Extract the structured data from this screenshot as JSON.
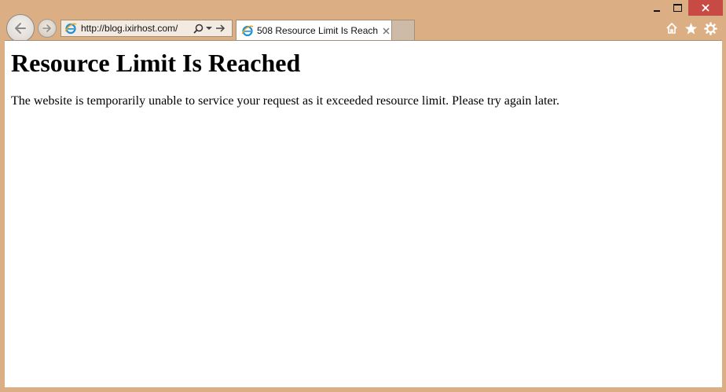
{
  "window": {
    "controls": {
      "minimize_icon": "minimize-icon",
      "maximize_icon": "maximize-icon",
      "close_icon": "close-icon",
      "close_color": "#c74a44"
    },
    "frame_color": "#dcae83"
  },
  "toolbar": {
    "address": {
      "url": "http://blog.ixirhost.com/",
      "icons": [
        "ie-favicon-icon",
        "search-icon",
        "dropdown-arrow-icon",
        "go-arrow-icon"
      ]
    },
    "nav_icons": [
      "back-arrow-icon",
      "forward-arrow-icon"
    ],
    "right_icons": [
      "home-icon",
      "favorites-star-icon",
      "gear-icon"
    ]
  },
  "tabs": [
    {
      "title": "508 Resource Limit Is Reach...",
      "active": true,
      "icon": "ie-favicon-icon"
    }
  ],
  "page": {
    "heading": "Resource Limit Is Reached",
    "message": "The website is temporarily unable to service your request as it exceeded resource limit. Please try again later."
  }
}
